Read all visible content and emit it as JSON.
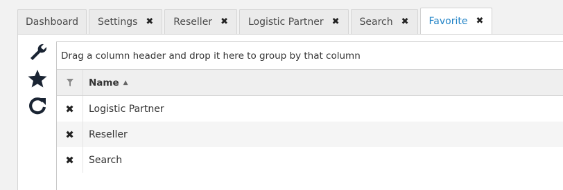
{
  "tabs": [
    {
      "label": "Dashboard",
      "closable": false,
      "active": false
    },
    {
      "label": "Settings",
      "closable": true,
      "active": false
    },
    {
      "label": "Reseller",
      "closable": true,
      "active": false
    },
    {
      "label": "Logistic Partner",
      "closable": true,
      "active": false
    },
    {
      "label": "Search",
      "closable": true,
      "active": false
    },
    {
      "label": "Favorite",
      "closable": true,
      "active": true
    }
  ],
  "close_glyph": "✖",
  "toolbar": {
    "icons": [
      "wrench-icon",
      "star-icon",
      "refresh-icon"
    ]
  },
  "grid": {
    "group_hint": "Drag a column header and drop it here to group by that column",
    "columns": [
      {
        "label": "Name",
        "sort": "ascending",
        "sort_glyph": "▲"
      }
    ],
    "rows": [
      {
        "name": "Logistic Partner"
      },
      {
        "name": "Reseller"
      },
      {
        "name": "Search"
      }
    ]
  },
  "colors": {
    "active_tab_text": "#1f82c6",
    "icon": "#1a2433"
  }
}
